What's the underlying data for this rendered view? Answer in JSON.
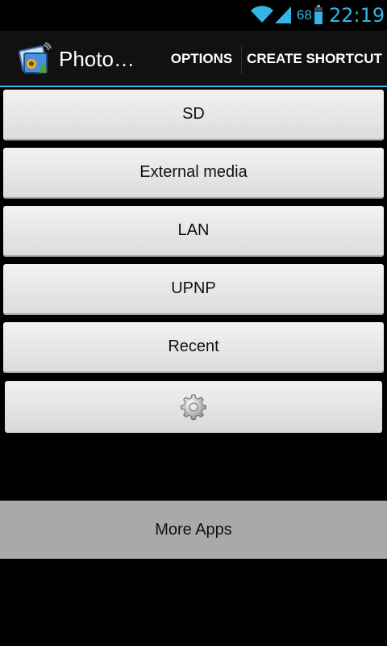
{
  "status_bar": {
    "battery": "68",
    "time": "22:19",
    "accent_color": "#33b5e5"
  },
  "action_bar": {
    "title": "Photo…",
    "options_label": "OPTIONS",
    "shortcut_label": "CREATE SHORTCUT",
    "app_icon": "photo-icon"
  },
  "menu": {
    "items": [
      {
        "label": "SD"
      },
      {
        "label": "External media"
      },
      {
        "label": "LAN"
      },
      {
        "label": "UPNP"
      },
      {
        "label": "Recent"
      }
    ],
    "settings_icon": "gear-icon"
  },
  "footer": {
    "more_apps_label": "More Apps"
  }
}
